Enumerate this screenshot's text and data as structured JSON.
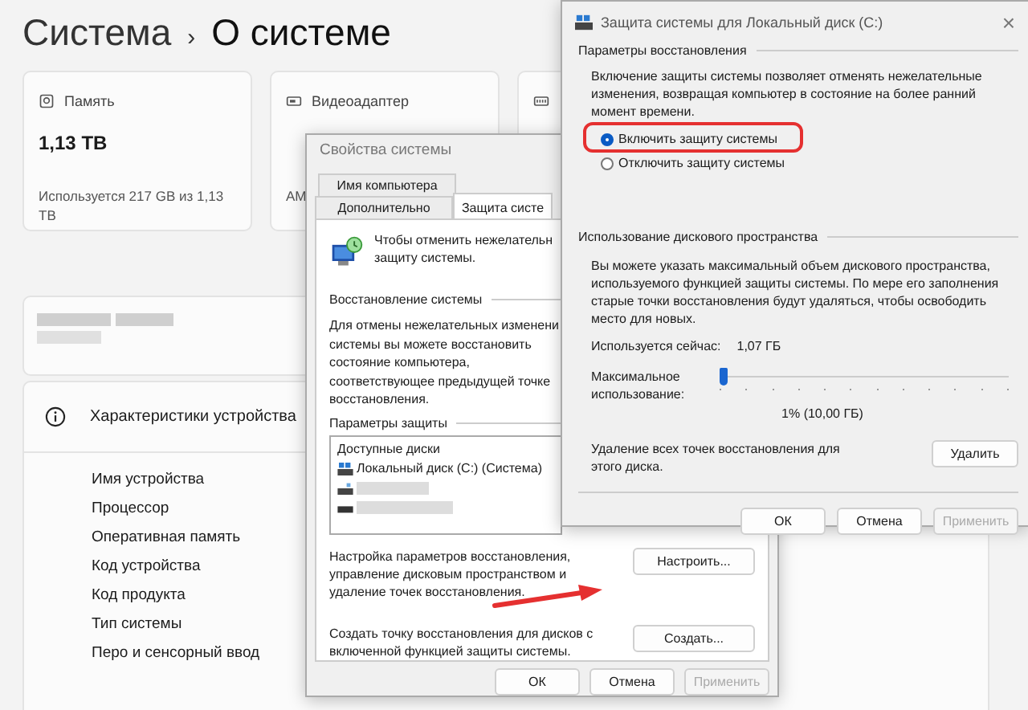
{
  "settings": {
    "breadcrumb": {
      "parent": "Система",
      "separator": "›",
      "current": "О системе"
    },
    "cards": [
      {
        "kind": "storage",
        "title": "Память",
        "value": "1,13 TB",
        "note": "Используется 217 GB из 1,13 TB"
      },
      {
        "kind": "gpu",
        "title": "Видеоадаптер",
        "note": "AM"
      },
      {
        "kind": "memory"
      }
    ],
    "specs": {
      "title": "Характеристики устройства",
      "rows": [
        "Имя устройства",
        "Процессор",
        "Оперативная память",
        "Код устройства",
        "Код продукта",
        "Тип системы",
        "Перо и сенсорный ввод"
      ]
    }
  },
  "system_properties": {
    "title": "Свойства системы",
    "tab_rows": [
      [
        {
          "label": "Имя компьютера",
          "selected": false
        }
      ],
      [
        {
          "label": "Дополнительно",
          "selected": false
        },
        {
          "label": "Защита систе",
          "selected": true
        }
      ]
    ],
    "intro": [
      "Чтобы отменить нежелательн",
      "защиту системы."
    ],
    "restore_group": "Восстановление системы",
    "restore_text": [
      "Для отмены нежелательных изменени",
      "системы вы можете восстановить",
      "состояние компьютера,",
      "соответствующее предыдущей точке",
      "восстановления."
    ],
    "protection_group": "Параметры защиты",
    "drives_header": "Доступные диски",
    "drives": [
      {
        "kind": "system",
        "label": "Локальный диск (C:) (Система)"
      },
      {
        "kind": "removable"
      },
      {
        "kind": "drive"
      }
    ],
    "configure_text": "Настройка параметров восстановления, управление дисковым пространством и удаление точек восстановления.",
    "configure_button": "Настроить...",
    "create_text": "Создать точку восстановления для дисков с включенной функцией защиты системы.",
    "create_button": "Создать...",
    "buttons": [
      {
        "label": "ОК",
        "disabled": false
      },
      {
        "label": "Отмена",
        "disabled": false
      },
      {
        "label": "Применить",
        "disabled": true
      }
    ]
  },
  "protection_dialog": {
    "title": "Защита системы для Локальный диск (C:)",
    "close": "×",
    "restore_group": "Параметры восстановления",
    "restore_text": "Включение защиты системы позволяет отменять нежелательные изменения, возвращая компьютер в состояние на более ранний момент времени.",
    "options": [
      {
        "label": "Включить защиту системы",
        "selected": true
      },
      {
        "label": "Отключить защиту системы",
        "selected": false
      }
    ],
    "usage_group": "Использование дискового пространства",
    "usage_text": "Вы можете указать максимальный объем дискового пространства, используемого функцией защиты системы. По мере его заполнения старые точки восстановления будут удаляться, чтобы освободить место для новых.",
    "used_label": "Используется сейчас:",
    "used_value": "1,07 ГБ",
    "max_label": "Максимальное использование:",
    "slider": {
      "level": 0.01
    },
    "max_value": "1% (10,00 ГБ)",
    "delete_text": "Удаление всех точек восстановления для этого диска.",
    "delete_button": "Удалить",
    "buttons": [
      {
        "label": "ОК",
        "disabled": false
      },
      {
        "label": "Отмена",
        "disabled": false
      },
      {
        "label": "Применить",
        "disabled": true
      }
    ]
  }
}
